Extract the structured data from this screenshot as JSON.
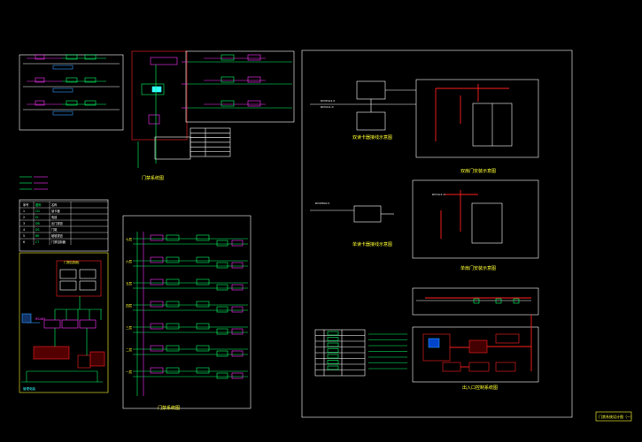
{
  "colors": {
    "background": "#000000",
    "frame": "#ffffff",
    "wire_green": "#00ff66",
    "wire_magenta": "#ff33ff",
    "wire_red": "#ff2020",
    "label_yellow": "#ffff33",
    "label_cyan": "#33ffff",
    "device_blue": "#3399ff"
  },
  "captions": {
    "system_a": "门禁系统图",
    "system_b": "门禁系统图",
    "door_a": "双扇门安装示意图",
    "door_b": "单扇门安装示意图",
    "reader_a": "双读卡器接线示意图",
    "reader_b": "单读卡器接线示意图",
    "entrance": "出入口控制系统图",
    "sheet_title": "门禁系统设计图（一）"
  },
  "legend": {
    "headers": [
      "序号",
      "图例",
      "名称"
    ],
    "rows": [
      [
        "1",
        "CD",
        "读卡器"
      ],
      [
        "2",
        "EL",
        "电锁"
      ],
      [
        "3",
        "DB",
        "出门按钮"
      ],
      [
        "4",
        "DS",
        "门磁"
      ],
      [
        "5",
        "BR",
        "破玻按钮"
      ],
      [
        "6",
        "CT",
        "门禁控制器"
      ]
    ]
  },
  "controller_panel": {
    "box_label": "门禁控制柜",
    "bus_label": "RS485",
    "pc_label": "管理电脑"
  },
  "riser_floors": [
    "七层",
    "六层",
    "五层",
    "四层",
    "三层",
    "二层",
    "一层"
  ],
  "wiring_notes": {
    "cable_1": "RVVP4x1.0",
    "cable_2": "RVV2x1.0",
    "cable_3": "RVVP8x0.5",
    "cable_4": "RVV4x1.0"
  }
}
